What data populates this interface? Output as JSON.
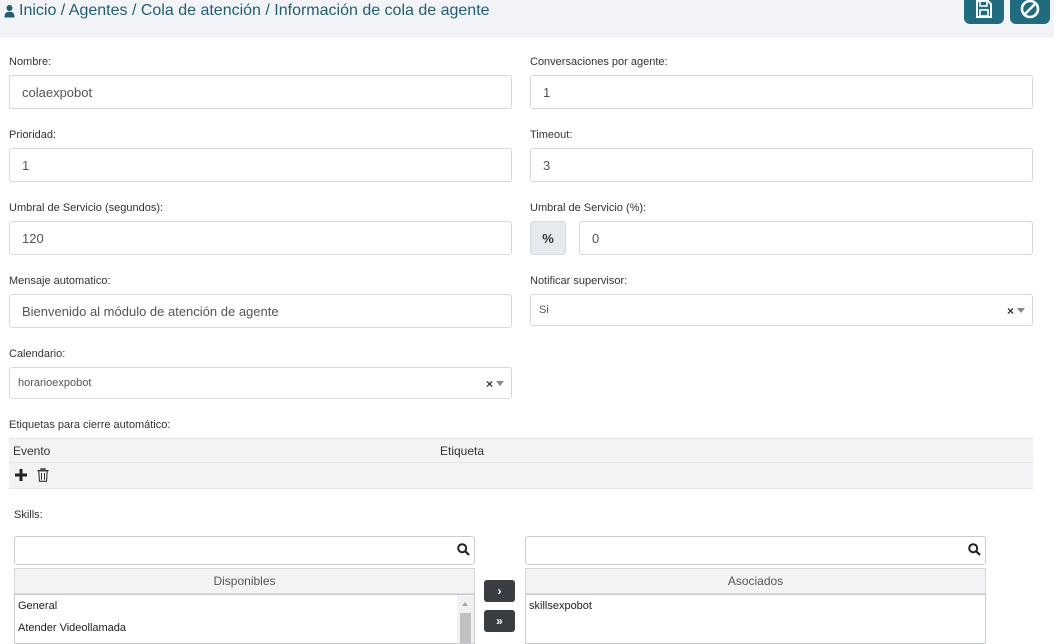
{
  "breadcrumb": {
    "text": "Inicio / Agentes / Cola de atención / Información de cola de agente"
  },
  "form": {
    "nombre": {
      "label": "Nombre:",
      "value": "colaexpobot"
    },
    "conversaciones": {
      "label": "Conversaciones por agente:",
      "value": "1"
    },
    "prioridad": {
      "label": "Prioridad:",
      "value": "1"
    },
    "timeout": {
      "label": "Timeout:",
      "value": "3"
    },
    "umbral_seg": {
      "label": "Umbral de Servicio (segundos):",
      "value": "120"
    },
    "umbral_pct": {
      "label": "Umbral de Servicio (%):",
      "addon": "%",
      "value": "0"
    },
    "mensaje": {
      "label": "Mensaje automatico:",
      "value": "Bienvenido al módulo de atención de agente"
    },
    "notificar": {
      "label": "Notificar supervisor:",
      "value": "Si"
    },
    "calendario": {
      "label": "Calendario:",
      "value": "horarioexpobot"
    }
  },
  "etiquetas": {
    "label": "Etiquetas para cierre automático:",
    "columns": [
      "Evento",
      "Etiqueta"
    ]
  },
  "skills": {
    "label": "Skills:",
    "available_header": "Disponibles",
    "associated_header": "Asociados",
    "available": [
      "General",
      "Atender Videollamada"
    ],
    "associated": [
      "skillsexpobot"
    ],
    "move_one": "›",
    "move_all": "»"
  },
  "colors": {
    "accent": "#1f6b7f",
    "breadcrumb": "#1f5f74",
    "dark_button": "#3a3d42"
  }
}
